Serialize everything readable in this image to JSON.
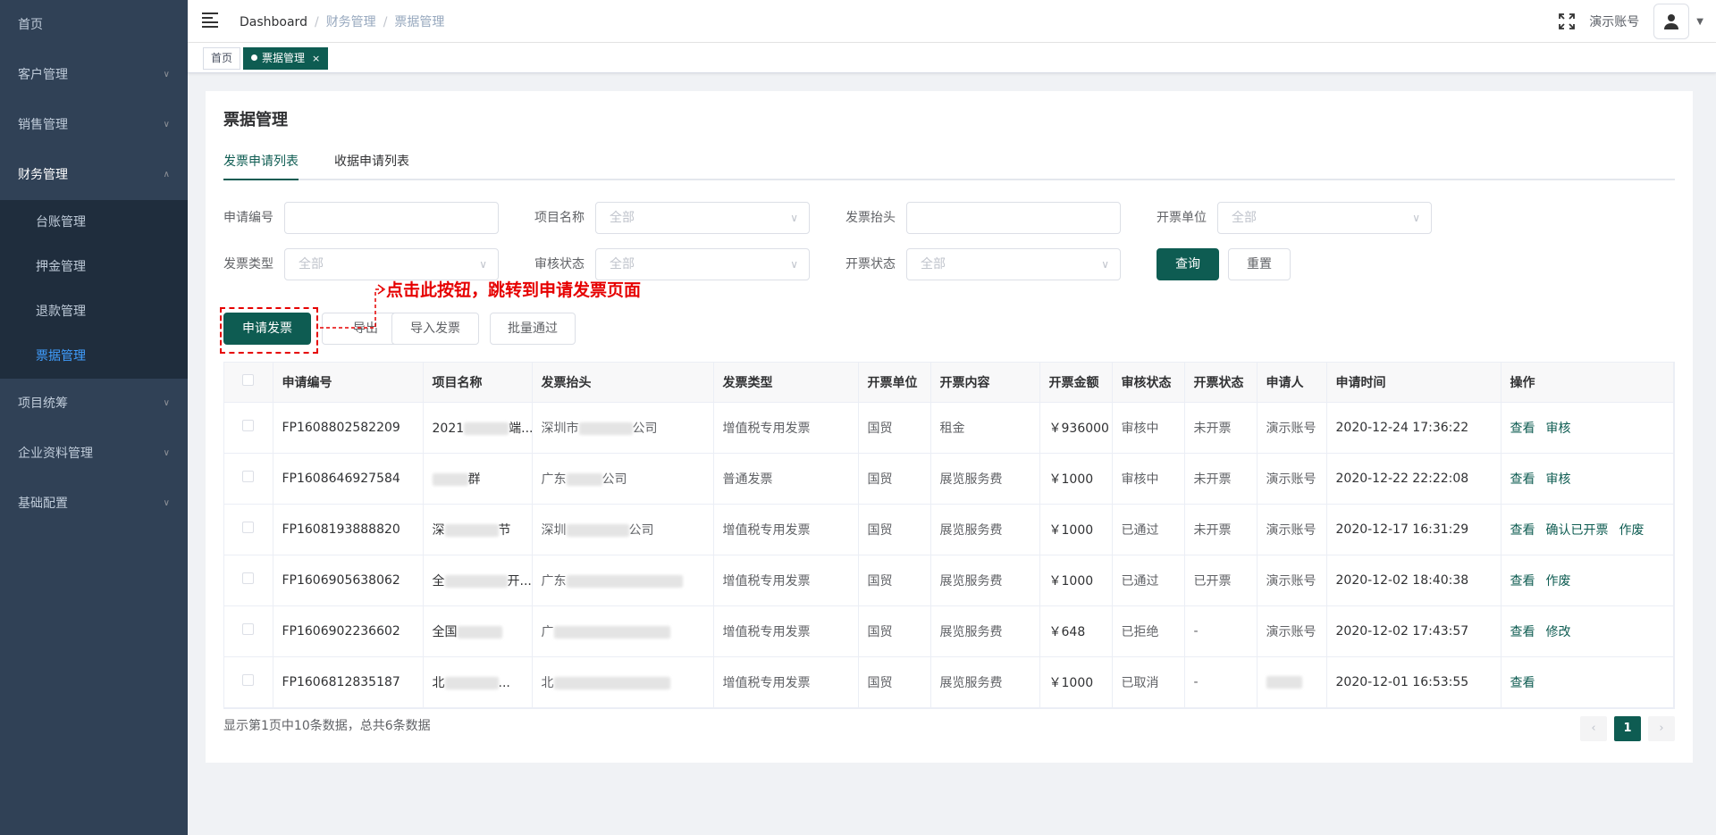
{
  "sidebar": {
    "items": [
      {
        "label": "首页",
        "has_children": false
      },
      {
        "label": "客户管理",
        "has_children": true
      },
      {
        "label": "销售管理",
        "has_children": true
      },
      {
        "label": "财务管理",
        "has_children": true,
        "open": true
      },
      {
        "label": "项目统筹",
        "has_children": true
      },
      {
        "label": "企业资料管理",
        "has_children": true
      },
      {
        "label": "基础配置",
        "has_children": true
      }
    ],
    "finance_sub": [
      "台账管理",
      "押金管理",
      "退款管理",
      "票据管理"
    ]
  },
  "header": {
    "breadcrumb": [
      "Dashboard",
      "财务管理",
      "票据管理"
    ],
    "account": "演示账号"
  },
  "tags": {
    "home": "首页",
    "current": "票据管理",
    "close": "×"
  },
  "page": {
    "title": "票据管理",
    "tabs": [
      "发票申请列表",
      "收据申请列表"
    ]
  },
  "filters": {
    "apply_no": "申请编号",
    "project": "项目名称",
    "invoice_title": "发票抬头",
    "issuer": "开票单位",
    "invoice_type": "发票类型",
    "review_status": "审核状态",
    "invoice_status": "开票状态",
    "placeholder_all": "全部",
    "query": "查询",
    "reset": "重置"
  },
  "actions": {
    "apply": "申请发票",
    "export": "导出",
    "import": "导入发票",
    "batch_pass": "批量通过"
  },
  "annotation": "点击此按钮，跳转到申请发票页面",
  "table": {
    "headers": [
      "申请编号",
      "项目名称",
      "发票抬头",
      "发票类型",
      "开票单位",
      "开票内容",
      "开票金额",
      "审核状态",
      "开票状态",
      "申请人",
      "申请时间",
      "操作"
    ],
    "rows": [
      {
        "no": "FP1608802582209",
        "project": "2021",
        "project_tail": "端...",
        "title": "深圳市",
        "title_tail": "公司",
        "type": "增值税专用发票",
        "issuer": "国贸",
        "content": "租金",
        "amount": "￥936000",
        "review": "审核中",
        "status": "未开票",
        "applicant": "演示账号",
        "time": "2020-12-24 17:36:22",
        "ops": [
          "查看",
          "审核"
        ]
      },
      {
        "no": "FP1608646927584",
        "project": "",
        "project_tail": "群",
        "title": "广东",
        "title_tail": "公司",
        "type": "普通发票",
        "issuer": "国贸",
        "content": "展览服务费",
        "amount": "￥1000",
        "review": "审核中",
        "status": "未开票",
        "applicant": "演示账号",
        "time": "2020-12-22 22:22:08",
        "ops": [
          "查看",
          "审核"
        ]
      },
      {
        "no": "FP1608193888820",
        "project": "深",
        "project_tail": "节",
        "title": "深圳",
        "title_tail": "公司",
        "type": "增值税专用发票",
        "issuer": "国贸",
        "content": "展览服务费",
        "amount": "￥1000",
        "review": "已通过",
        "status": "未开票",
        "applicant": "演示账号",
        "time": "2020-12-17 16:31:29",
        "ops": [
          "查看",
          "确认已开票",
          "作废"
        ]
      },
      {
        "no": "FP1606905638062",
        "project": "全",
        "project_tail": "开...",
        "title": "广东",
        "title_tail": "",
        "type": "增值税专用发票",
        "issuer": "国贸",
        "content": "展览服务费",
        "amount": "￥1000",
        "review": "已通过",
        "status": "已开票",
        "applicant": "演示账号",
        "time": "2020-12-02 18:40:38",
        "ops": [
          "查看",
          "作废"
        ]
      },
      {
        "no": "FP1606902236602",
        "project": "全国",
        "project_tail": "",
        "title": "广",
        "title_tail": "",
        "type": "增值税专用发票",
        "issuer": "国贸",
        "content": "展览服务费",
        "amount": "￥648",
        "review": "已拒绝",
        "status": "-",
        "applicant": "演示账号",
        "time": "2020-12-02 17:43:57",
        "ops": [
          "查看",
          "修改"
        ]
      },
      {
        "no": "FP1606812835187",
        "project": "北",
        "project_tail": "...",
        "title": "北",
        "title_tail": "",
        "type": "增值税专用发票",
        "issuer": "国贸",
        "content": "展览服务费",
        "amount": "￥1000",
        "review": "已取消",
        "status": "-",
        "applicant": "",
        "time": "2020-12-01 16:53:55",
        "ops": [
          "查看"
        ]
      }
    ]
  },
  "footer": {
    "info": "显示第1页中10条数据，总共6条数据",
    "page": "1"
  },
  "colors": {
    "primary": "#0e5c52",
    "sidebar": "#304156",
    "annotation": "#e60000"
  }
}
